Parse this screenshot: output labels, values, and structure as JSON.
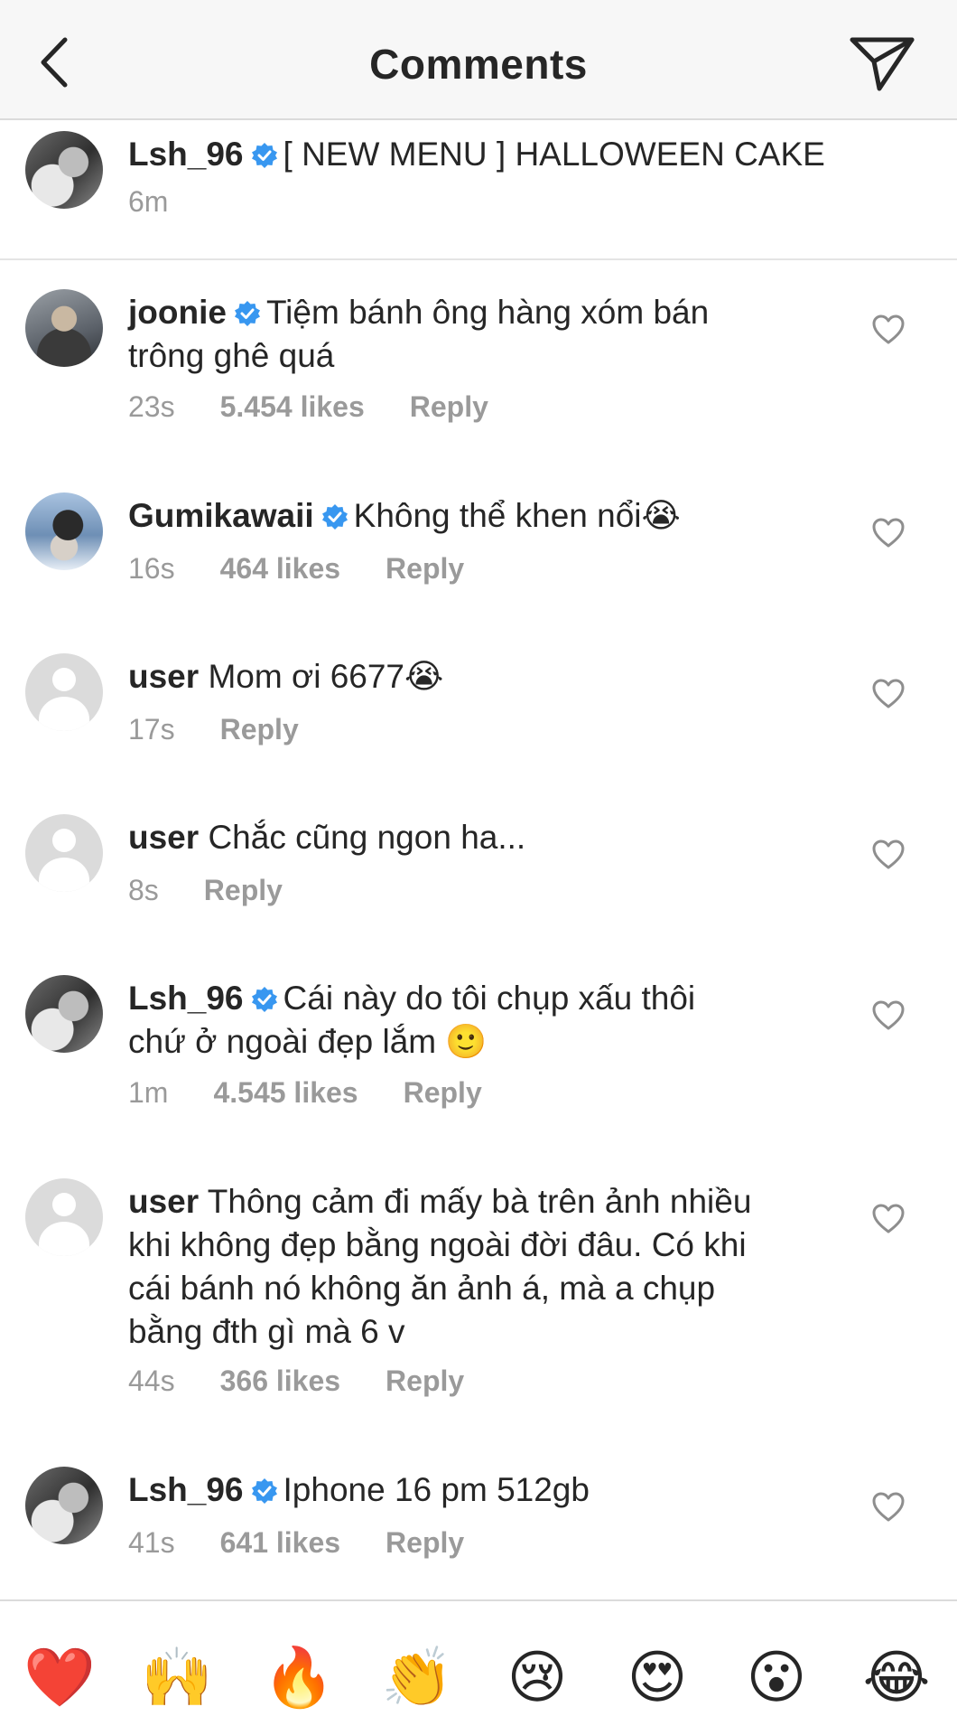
{
  "header": {
    "title": "Comments"
  },
  "caption": {
    "username": "Lsh_96",
    "text": "[ NEW MENU ] HALLOWEEN CAKE",
    "time": "6m"
  },
  "comments": [
    {
      "username": "joonie",
      "verified": true,
      "text_line1": "Tiệm bánh ông hàng xóm bán",
      "text_line2": "trông ghê quá",
      "time": "23s",
      "likes": "5.454 likes",
      "reply": "Reply"
    },
    {
      "username": "Gumikawaii",
      "verified": true,
      "text_line1": "Không thể khen nổi😭",
      "time": "16s",
      "likes": "464 likes",
      "reply": "Reply"
    },
    {
      "username": "user",
      "verified": false,
      "text_line1": "Mom ơi 6677😭",
      "time": "17s",
      "reply": "Reply"
    },
    {
      "username": "user",
      "verified": false,
      "text_line1": "Chắc cũng ngon ha...",
      "time": "8s",
      "reply": "Reply"
    },
    {
      "username": "Lsh_96",
      "verified": true,
      "text_line1": "Cái này do tôi chụp xấu thôi",
      "text_line2": "chứ ở ngoài đẹp lắm 🙂",
      "time": "1m",
      "likes": "4.545 likes",
      "reply": "Reply"
    },
    {
      "username": "user",
      "verified": false,
      "text_line1": "Thông cảm đi mấy bà trên ảnh nhiều",
      "text_line2": "khi không đẹp bằng ngoài đời đâu. Có khi",
      "text_line3": "cái bánh nó không ăn ảnh á, mà a chụp",
      "text_line4": "bằng đth gì mà 6 v",
      "time": "44s",
      "likes": "366 likes",
      "reply": "Reply"
    },
    {
      "username": "Lsh_96",
      "verified": true,
      "text_line1": "Iphone 16 pm 512gb",
      "time": "41s",
      "likes": "641 likes",
      "reply": "Reply"
    }
  ],
  "emoji_bar": [
    "❤️",
    "🙌",
    "🔥",
    "👏",
    "😢",
    "😍",
    "😮",
    "😂"
  ],
  "colors": {
    "verified": "#3897f0",
    "meta_gray": "#9a9a9a",
    "text": "#262626"
  }
}
